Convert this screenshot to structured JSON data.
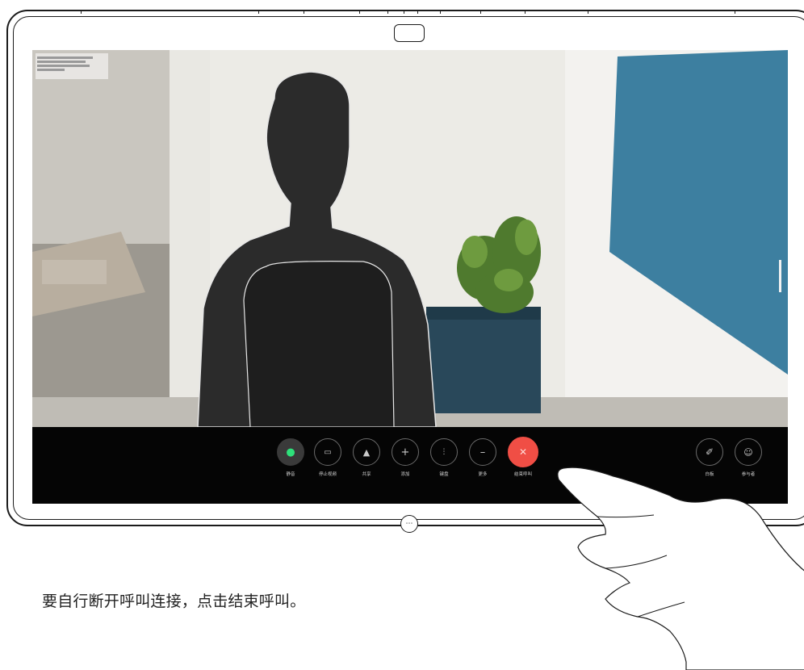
{
  "controls": [
    {
      "icon": "microphone-icon",
      "label": "静音",
      "state": "active-green"
    },
    {
      "icon": "camera-icon",
      "label": "停止视频",
      "state": "normal"
    },
    {
      "icon": "share-icon",
      "label": "共享",
      "state": "normal"
    },
    {
      "icon": "plus-icon",
      "label": "添加",
      "state": "normal"
    },
    {
      "icon": "keypad-icon",
      "label": "键盘",
      "state": "normal"
    },
    {
      "icon": "more-icon",
      "label": "更多",
      "state": "normal"
    },
    {
      "icon": "end-call-icon",
      "label": "结束呼叫",
      "state": "danger"
    }
  ],
  "right_controls": [
    {
      "icon": "edit-icon",
      "label": "白板"
    },
    {
      "icon": "participants-icon",
      "label": "参与者"
    }
  ],
  "caption": "要自行断开呼叫连接，点击结束呼叫。",
  "colors": {
    "end_call": "#f04e45",
    "mute_icon": "#2ee07a",
    "control_bar": "#050505"
  }
}
